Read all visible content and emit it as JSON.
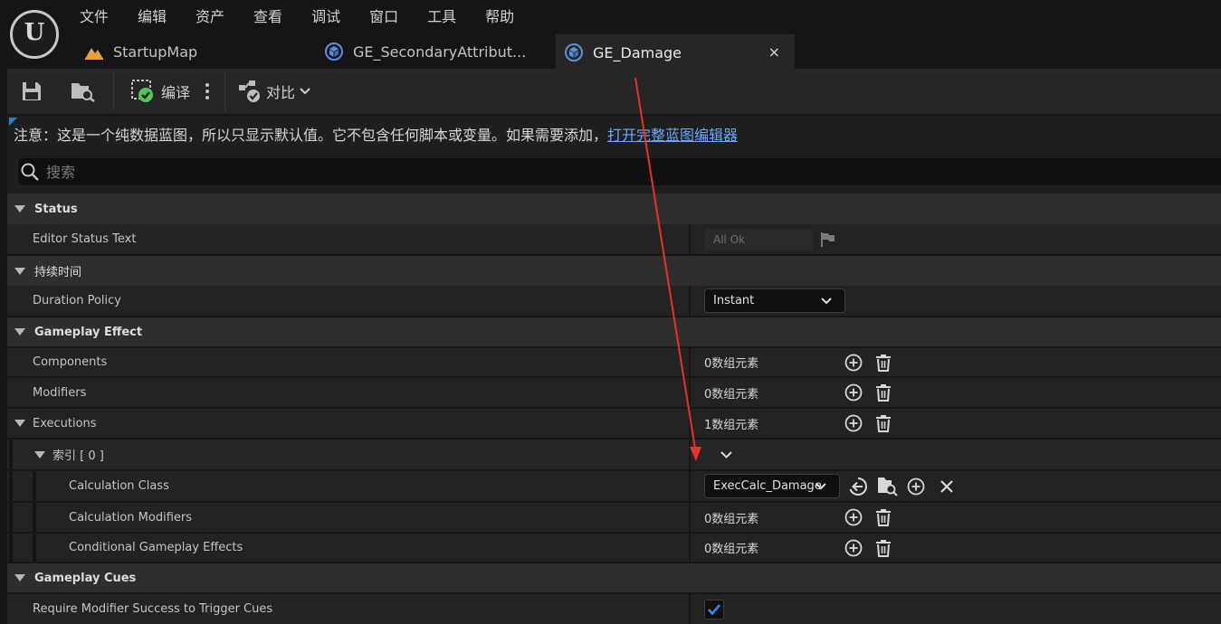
{
  "menu": [
    "文件",
    "编辑",
    "资产",
    "查看",
    "调试",
    "窗口",
    "工具",
    "帮助"
  ],
  "logo_text": "U",
  "tabs": [
    {
      "label": "StartupMap"
    },
    {
      "label": "GE_SecondaryAttribut..."
    },
    {
      "label": "GE_Damage",
      "active": true,
      "close": "×"
    }
  ],
  "toolbar": {
    "compile_label": "编译",
    "diff_label": "对比"
  },
  "notice": {
    "text": "注意：这是一个纯数据蓝图，所以只显示默认值。它不包含任何脚本或变量。如果需要添加，",
    "link": "打开完整蓝图编辑器"
  },
  "search": {
    "placeholder": "搜索"
  },
  "details": {
    "status_cat": "Status",
    "editor_status_text": "Editor Status Text",
    "editor_status_value": "All Ok",
    "duration_cat": "持续时间",
    "duration_policy": "Duration Policy",
    "duration_policy_value": "Instant",
    "ge_cat": "Gameplay Effect",
    "components": "Components",
    "components_value": "0数组元素",
    "modifiers": "Modifiers",
    "modifiers_value": "0数组元素",
    "executions": "Executions",
    "executions_value": "1数组元素",
    "index0": "索引 [ 0 ]",
    "calc_class": "Calculation Class",
    "calc_class_value": "ExecCalc_Damage",
    "calc_modifiers": "Calculation Modifiers",
    "calc_modifiers_value": "0数组元素",
    "cond_effects": "Conditional Gameplay Effects",
    "cond_effects_value": "0数组元素",
    "cues_cat": "Gameplay Cues",
    "require_success": "Require Modifier Success to Trigger Cues",
    "require_success_checked": true
  },
  "colors": {
    "accent": "#2f7fd6",
    "link": "#6ca8ff",
    "annotation_arrow": "#e8312a"
  }
}
